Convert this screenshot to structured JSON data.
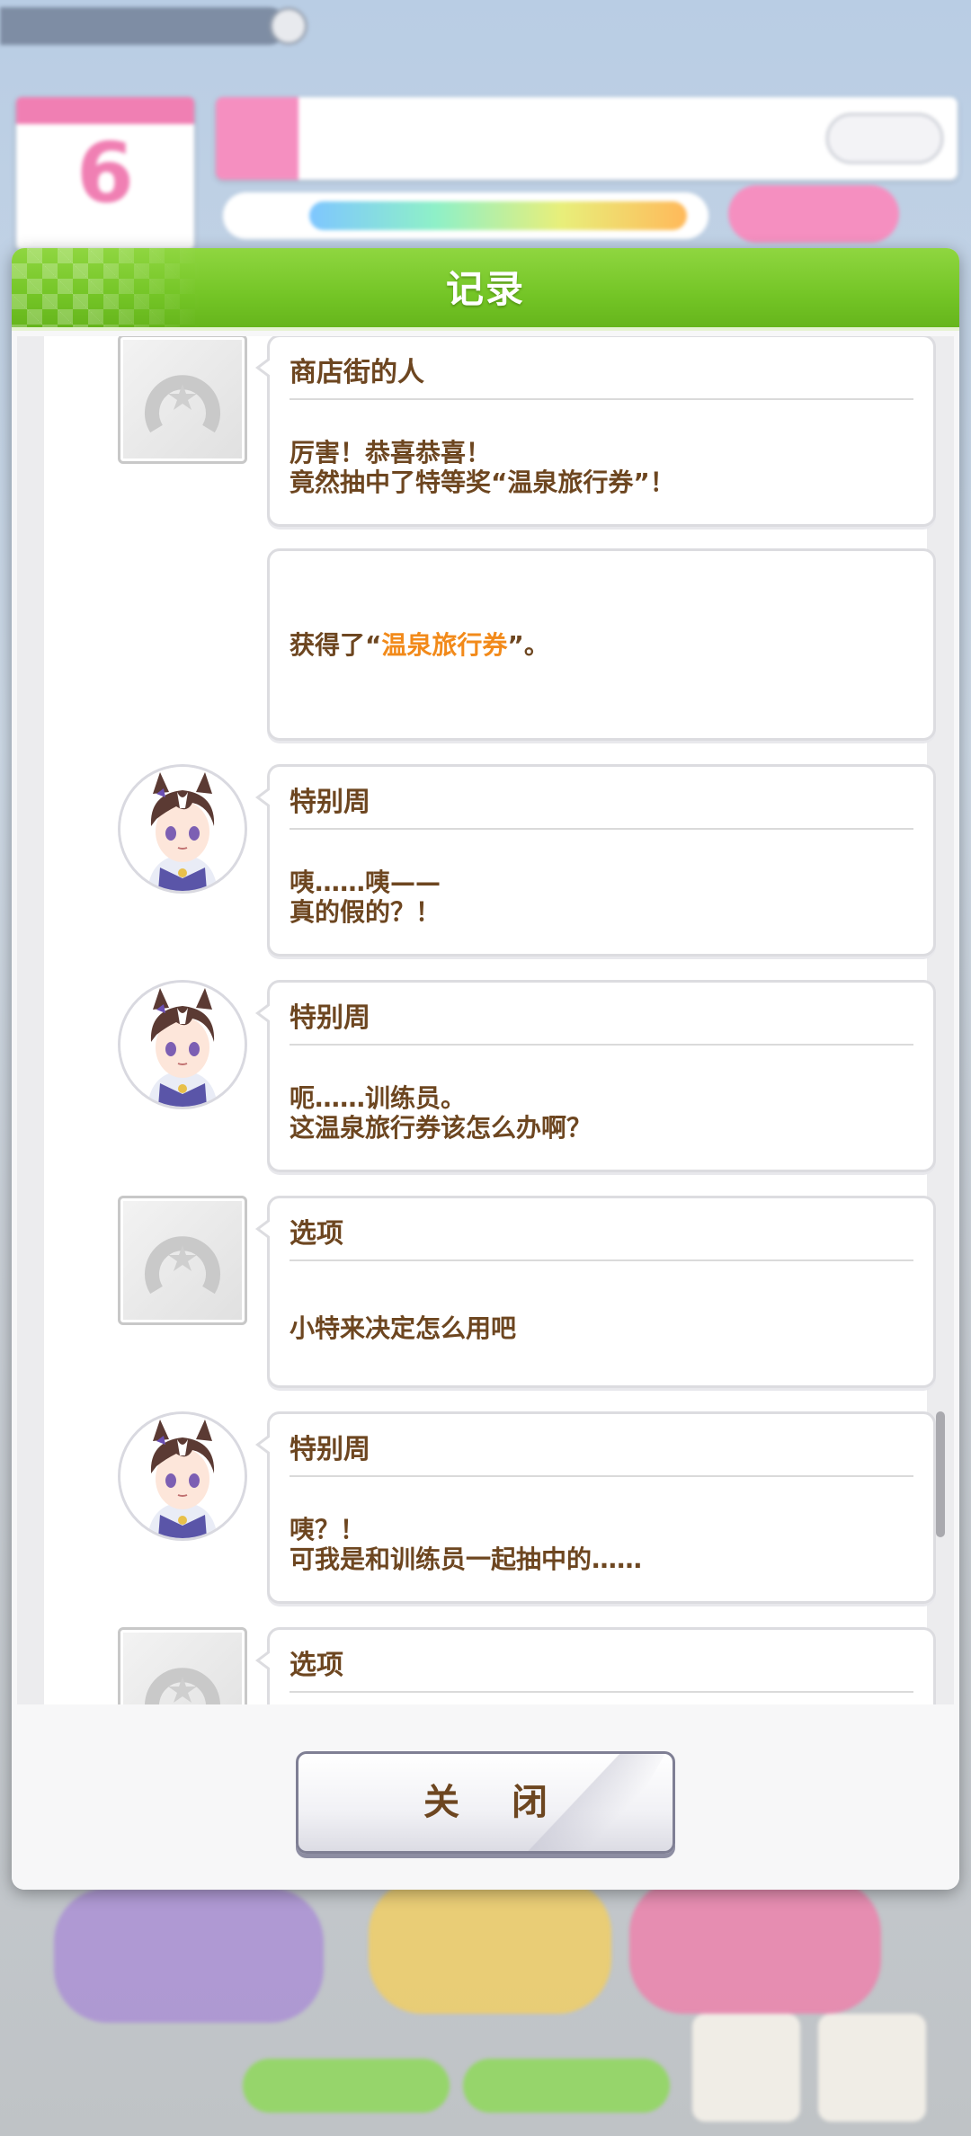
{
  "dialog": {
    "title": "记录",
    "close_label": "关 闭"
  },
  "background": {
    "calendar_day": "6"
  },
  "log": [
    {
      "speaker": "商店街的人",
      "avatar": "horseshoe-placeholder-icon",
      "message": "厉害！恭喜恭喜！\n竟然抽中了特等奖“温泉旅行券”！"
    },
    {
      "speaker": "",
      "avatar": "",
      "message_prefix": "获得了“",
      "message_highlight": "温泉旅行券",
      "message_suffix": "”。"
    },
    {
      "speaker": "特别周",
      "avatar": "special-week-portrait",
      "message": "咦……咦——\n真的假的？！"
    },
    {
      "speaker": "特别周",
      "avatar": "special-week-portrait",
      "message": "呃……训练员。\n这温泉旅行券该怎么办啊？"
    },
    {
      "speaker": "选项",
      "avatar": "horseshoe-placeholder-icon",
      "message": "小特来决定怎么用吧"
    },
    {
      "speaker": "特别周",
      "avatar": "special-week-portrait",
      "message": "咦？！\n可我是和训练员一起抽中的……"
    },
    {
      "speaker": "选项",
      "avatar": "horseshoe-placeholder-icon",
      "message": ""
    }
  ],
  "colors": {
    "header_green": "#74c526",
    "text_brown": "#6d4620",
    "highlight_orange": "#f28a1a"
  }
}
